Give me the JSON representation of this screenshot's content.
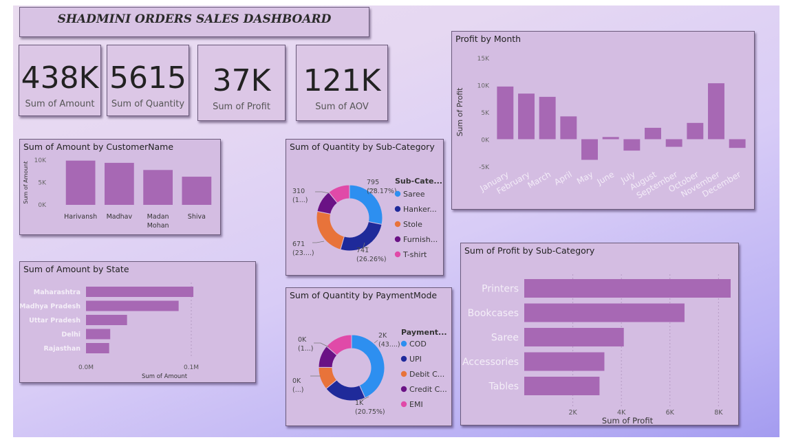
{
  "dashboard_title": "SHADMINI ORDERS SALES DASHBOARD",
  "colors": {
    "bar": "#a768b4",
    "donut": [
      "#2d8ff0",
      "#1f2a9a",
      "#e8733a",
      "#6a1285",
      "#e04aa8"
    ]
  },
  "kpis": [
    {
      "value": "438K",
      "label": "Sum of Amount"
    },
    {
      "value": "5615",
      "label": "Sum of Quantity"
    },
    {
      "value": "37K",
      "label": "Sum of Profit"
    },
    {
      "value": "121K",
      "label": "Sum of AOV"
    }
  ],
  "chart_data": [
    {
      "id": "profit_by_month",
      "type": "bar",
      "title": "Profit by Month",
      "ylabel": "Sum of Profit",
      "ylim": [
        -5000,
        15000
      ],
      "yticks": [
        -5000,
        0,
        5000,
        10000,
        15000
      ],
      "ytick_labels": [
        "-5K",
        "0K",
        "5K",
        "10K",
        "15K"
      ],
      "categories": [
        "January",
        "February",
        "March",
        "April",
        "May",
        "June",
        "July",
        "August",
        "September",
        "October",
        "November",
        "December"
      ],
      "values": [
        9700,
        8400,
        7800,
        4200,
        -3800,
        400,
        -2100,
        2100,
        -1400,
        3000,
        10300,
        -1600
      ]
    },
    {
      "id": "amount_by_customer",
      "type": "bar",
      "title": "Sum of Amount by CustomerName",
      "ylabel": "Sum of Amount",
      "ylim": [
        0,
        10000
      ],
      "yticks": [
        0,
        5000,
        10000
      ],
      "ytick_labels": [
        "0K",
        "5K",
        "10K"
      ],
      "categories": [
        "Harivansh",
        "Madhav",
        "Madan Mohan",
        "Shiva"
      ],
      "values": [
        9900,
        9400,
        7800,
        6300
      ]
    },
    {
      "id": "amount_by_state",
      "type": "bar",
      "orientation": "horizontal",
      "title": "Sum of Amount by State",
      "xlabel": "Sum of Amount",
      "xlim": [
        0,
        100000
      ],
      "xticks": [
        0,
        100000
      ],
      "xtick_labels": [
        "0.0M",
        "0.1M"
      ],
      "categories": [
        "Maharashtra",
        "Madhya Pradesh",
        "Uttar Pradesh",
        "Delhi",
        "Rajasthan"
      ],
      "values": [
        102000,
        88000,
        39000,
        23000,
        22000
      ]
    },
    {
      "id": "profit_by_subcategory",
      "type": "bar",
      "orientation": "horizontal",
      "title": "Sum of Profit by Sub-Category",
      "xlabel": "Sum of Profit",
      "xlim": [
        0,
        8500
      ],
      "xticks": [
        2000,
        4000,
        6000,
        8000
      ],
      "xtick_labels": [
        "2K",
        "4K",
        "6K",
        "8K"
      ],
      "categories": [
        "Printers",
        "Bookcases",
        "Saree",
        "Accessories",
        "Tables"
      ],
      "values": [
        8600,
        6600,
        4100,
        3300,
        3100
      ]
    },
    {
      "id": "quantity_by_subcategory",
      "type": "pie",
      "donut": true,
      "title": "Sum of Quantity by Sub-Category",
      "legend_title": "Sub-Cate...",
      "legend_entries": [
        "Saree",
        "Hanker...",
        "Stole",
        "Furnish...",
        "T-shirt"
      ],
      "values": [
        795,
        741,
        671,
        310,
        305
      ],
      "data_labels": [
        {
          "lines": [
            "795",
            "(28.17%)"
          ]
        },
        {
          "lines": [
            "741",
            "(26.26%)"
          ]
        },
        {
          "lines": [
            "671",
            "(23....)"
          ]
        },
        {
          "lines": [
            "310",
            "(1...)"
          ]
        }
      ]
    },
    {
      "id": "quantity_by_paymentmode",
      "type": "pie",
      "donut": true,
      "title": "Sum of Quantity by PaymentMode",
      "legend_title": "Payment...",
      "legend_entries": [
        "COD",
        "UPI",
        "Debit C...",
        "Credit C...",
        "EMI"
      ],
      "values": [
        2430,
        1166,
        630,
        620,
        770
      ],
      "data_labels": [
        {
          "lines": [
            "2K",
            "(43....)"
          ]
        },
        {
          "lines": [
            "1K",
            "(20.75%)"
          ]
        },
        {
          "lines": [
            "0K",
            "(...)"
          ]
        },
        {
          "lines": [
            "0K",
            "(1...)"
          ]
        }
      ]
    }
  ]
}
